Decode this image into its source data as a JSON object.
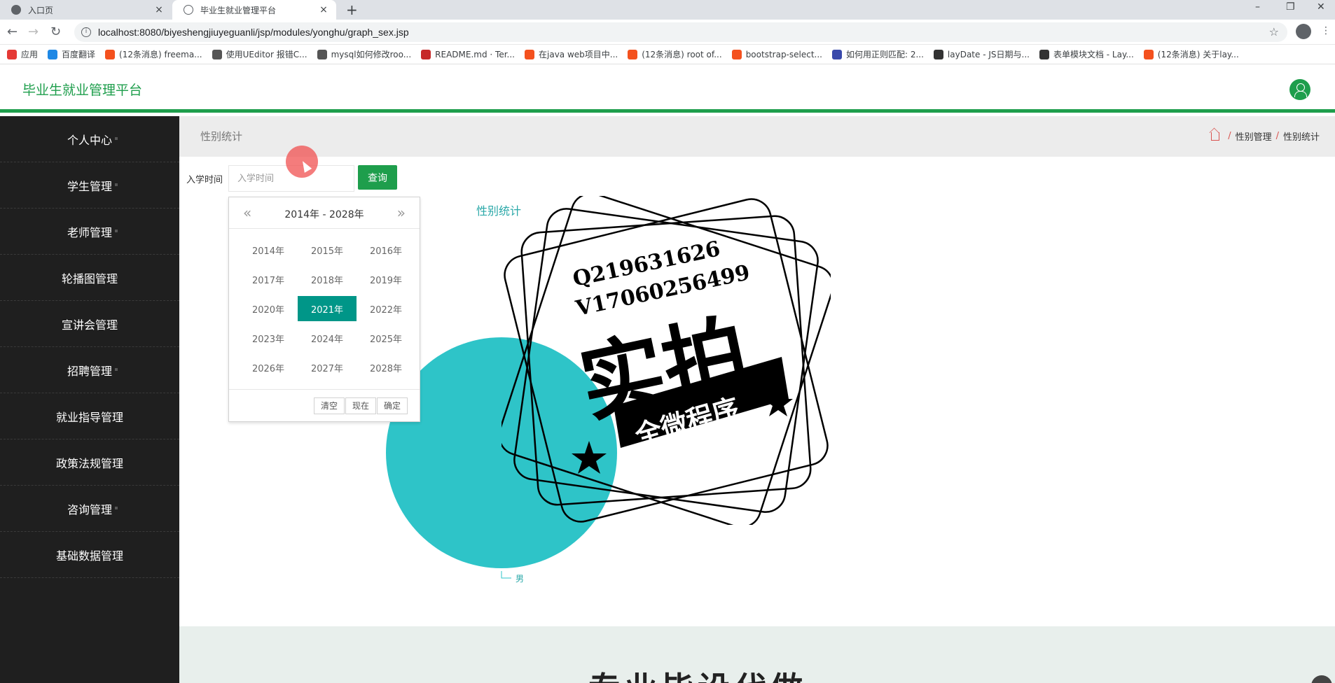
{
  "browser": {
    "tabs": [
      {
        "title": "入口页",
        "close": "×"
      },
      {
        "title": "毕业生就业管理平台",
        "close": "×"
      }
    ],
    "new_tab": "+",
    "url": "localhost:8080/biyeshengjiuyeguanli/jsp/modules/yonghu/graph_sex.jsp",
    "bookmarks": [
      {
        "label": "应用",
        "color": "#e53935"
      },
      {
        "label": "百度翻译",
        "color": "#1e88e5"
      },
      {
        "label": "(12条消息) freema...",
        "color": "#f4511e"
      },
      {
        "label": "使用UEditor 报错C...",
        "color": "#555555"
      },
      {
        "label": "mysql如何修改roo...",
        "color": "#555555"
      },
      {
        "label": "README.md · Ter...",
        "color": "#c62828"
      },
      {
        "label": "在java web项目中...",
        "color": "#f4511e"
      },
      {
        "label": "(12条消息) root of...",
        "color": "#f4511e"
      },
      {
        "label": "bootstrap-select...",
        "color": "#f4511e"
      },
      {
        "label": "如何用正则匹配: 2...",
        "color": "#3949ab"
      },
      {
        "label": "layDate - JS日期与...",
        "color": "#333333"
      },
      {
        "label": "表单模块文档 - Lay...",
        "color": "#333333"
      },
      {
        "label": "(12条消息) 关于lay...",
        "color": "#f4511e"
      }
    ]
  },
  "header": {
    "brand": "毕业生就业管理平台"
  },
  "sidebar": {
    "items": [
      {
        "label": "个人中心"
      },
      {
        "label": "学生管理"
      },
      {
        "label": "老师管理"
      },
      {
        "label": "轮播图管理"
      },
      {
        "label": "宣讲会管理"
      },
      {
        "label": "招聘管理"
      },
      {
        "label": "就业指导管理"
      },
      {
        "label": "政策法规管理"
      },
      {
        "label": "咨询管理"
      },
      {
        "label": "基础数据管理"
      }
    ]
  },
  "page": {
    "title": "性别统计",
    "breadcrumb": [
      "性别管理",
      "性别统计"
    ],
    "breadcrumb_sep": "/"
  },
  "search": {
    "label": "入学时间",
    "placeholder": "入学时间",
    "button": "查询"
  },
  "datepicker": {
    "prev": "«",
    "next": "»",
    "range": "2014年 - 2028年",
    "years": [
      "2014年",
      "2015年",
      "2016年",
      "2017年",
      "2018年",
      "2019年",
      "2020年",
      "2021年",
      "2022年",
      "2023年",
      "2024年",
      "2025年",
      "2026年",
      "2027年",
      "2028年"
    ],
    "selected": "2021年",
    "buttons": {
      "clear": "清空",
      "now": "现在",
      "confirm": "确定"
    }
  },
  "chart_data": {
    "type": "pie",
    "title": "性别统计",
    "categories": [
      "男"
    ],
    "values": [
      1
    ],
    "colors": [
      "#2ec4c8"
    ]
  },
  "watermark": {
    "line1": "Q219631626",
    "line2": "V17060256499",
    "big": "实拍",
    "banner": "全微程序"
  },
  "bottom": {
    "heading": "专业毕设代做"
  }
}
